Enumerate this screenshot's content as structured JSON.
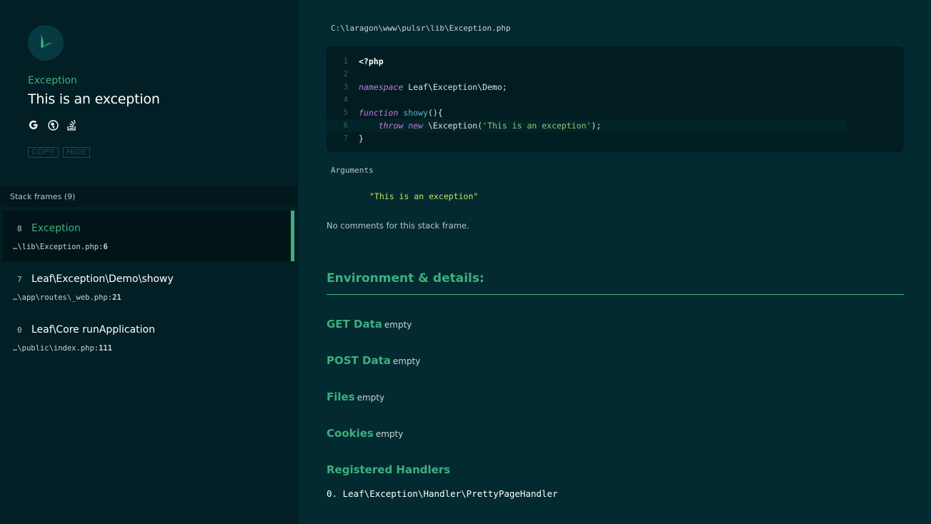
{
  "exception": {
    "type": "Exception",
    "message": "This is an exception"
  },
  "search_icons": [
    {
      "name": "google-icon",
      "glyph": "G"
    },
    {
      "name": "duckduckgo-icon",
      "glyph": "🦆"
    },
    {
      "name": "stackoverflow-icon",
      "glyph": "≡"
    }
  ],
  "actions": {
    "copy": "COPY",
    "hide": "HIDE"
  },
  "frames_header": "Stack frames (9)",
  "frames": [
    {
      "num": "8",
      "name": "Exception",
      "path_prefix": "…\\lib\\Exception.php:",
      "line": "6",
      "active": true
    },
    {
      "num": "7",
      "name": "Leaf\\Exception\\Demo\\showy",
      "path_prefix": "…\\app\\routes\\_web.php:",
      "line": "21",
      "active": false
    },
    {
      "num": "0",
      "name": "Leaf\\Core runApplication",
      "path_prefix": "…\\public\\index.php:",
      "line": "111",
      "active": false
    }
  ],
  "file_path": "C:\\laragon\\www\\pulsr\\lib\\Exception.php",
  "code_lines": [
    {
      "no": "1",
      "parts": [
        {
          "c": "tag",
          "t": "<?php"
        }
      ]
    },
    {
      "no": "2",
      "parts": []
    },
    {
      "no": "3",
      "parts": [
        {
          "c": "kw",
          "t": "namespace"
        },
        {
          "c": "tx",
          "t": " Leaf\\Exception\\Demo;"
        }
      ]
    },
    {
      "no": "4",
      "parts": []
    },
    {
      "no": "5",
      "parts": [
        {
          "c": "kw",
          "t": "function"
        },
        {
          "c": "tx",
          "t": " "
        },
        {
          "c": "fn",
          "t": "showy"
        },
        {
          "c": "tx",
          "t": "(){"
        }
      ]
    },
    {
      "no": "6",
      "parts": [
        {
          "c": "tx",
          "t": "    "
        },
        {
          "c": "kw",
          "t": "throw"
        },
        {
          "c": "tx",
          "t": " "
        },
        {
          "c": "kw",
          "t": "new"
        },
        {
          "c": "tx",
          "t": " \\Exception("
        },
        {
          "c": "str",
          "t": "'This is an exception'"
        },
        {
          "c": "tx",
          "t": ");"
        }
      ],
      "highlight": true
    },
    {
      "no": "7",
      "parts": [
        {
          "c": "tx",
          "t": "}"
        }
      ]
    }
  ],
  "arguments_label": "Arguments",
  "argument_value": "\"This is an exception\"",
  "no_comments": "No comments for this stack frame.",
  "environment": {
    "title": "Environment & details:",
    "sections": [
      {
        "label": "GET Data",
        "value": "empty"
      },
      {
        "label": "POST Data",
        "value": "empty"
      },
      {
        "label": "Files",
        "value": "empty"
      },
      {
        "label": "Cookies",
        "value": "empty"
      }
    ],
    "handlers_title": "Registered Handlers",
    "handlers": [
      "0. Leaf\\Exception\\Handler\\PrettyPageHandler"
    ]
  },
  "colors": {
    "accent": "#3eaf7c",
    "sidebar_bg": "#011f24",
    "main_bg": "#022a30"
  }
}
